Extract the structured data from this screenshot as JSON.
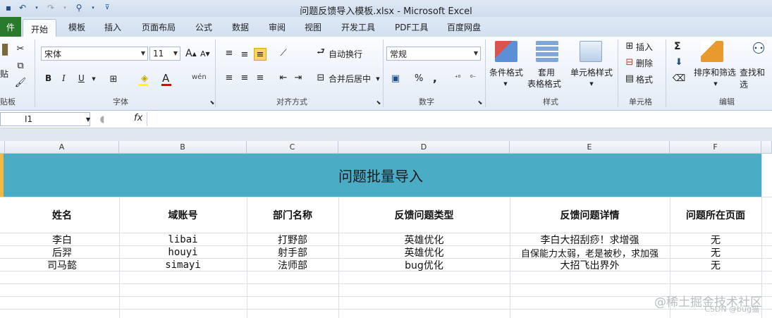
{
  "window": {
    "title": "问题反馈导入模板.xlsx  -  Microsoft Excel"
  },
  "tabs": {
    "file": "件",
    "items": [
      "开始",
      "模板",
      "插入",
      "页面布局",
      "公式",
      "数据",
      "审阅",
      "视图",
      "开发工具",
      "PDF工具",
      "百度网盘"
    ],
    "active": "开始"
  },
  "ribbon": {
    "clipboard": {
      "label": "贴板",
      "paste": "贴"
    },
    "font": {
      "label": "字体",
      "name": "宋体",
      "size": "11",
      "bold": "B",
      "italic": "I",
      "underline": "U",
      "grow": "A",
      "shrink": "A",
      "font_color": "A",
      "phonetic": "wén"
    },
    "alignment": {
      "label": "对齐方式",
      "wrap": "自动换行",
      "merge": "合并后居中"
    },
    "number": {
      "label": "数字",
      "format": "常规",
      "percent": "%",
      "comma": ","
    },
    "styles": {
      "label": "样式",
      "conditional": "条件格式",
      "table1": "套用",
      "table2": "表格格式",
      "cell_styles": "单元格样式"
    },
    "cells": {
      "label": "单元格",
      "insert": "插入",
      "delete": "删除",
      "format": "格式"
    },
    "editing": {
      "label": "编辑",
      "sum": "Σ",
      "sort": "排序和筛选",
      "find": "查找和选"
    }
  },
  "formula_bar": {
    "name_box": "I1",
    "fx": "fx",
    "content": ""
  },
  "columns": [
    "A",
    "B",
    "C",
    "D",
    "E",
    "F"
  ],
  "sheet": {
    "banner": "问题批量导入",
    "headers": [
      "姓名",
      "域账号",
      "部门名称",
      "反馈问题类型",
      "反馈问题详情",
      "问题所在页面"
    ],
    "rows": [
      [
        "李白",
        "libai",
        "打野部",
        "英雄优化",
        "李白大招刮痧！求增强",
        "无"
      ],
      [
        "后羿",
        "houyi",
        "射手部",
        "英雄优化",
        "自保能力太弱，老是被秒，求加强",
        "无"
      ],
      [
        "司马懿",
        "simayi",
        "法师部",
        "bug优化",
        "大招飞出界外",
        "无"
      ]
    ]
  },
  "watermark": {
    "main": "@稀土掘金技术社区",
    "sub": "CSDN @bug猫"
  },
  "colors": {
    "banner": "#4bacc6",
    "file_tab": "#2a7a2e"
  }
}
